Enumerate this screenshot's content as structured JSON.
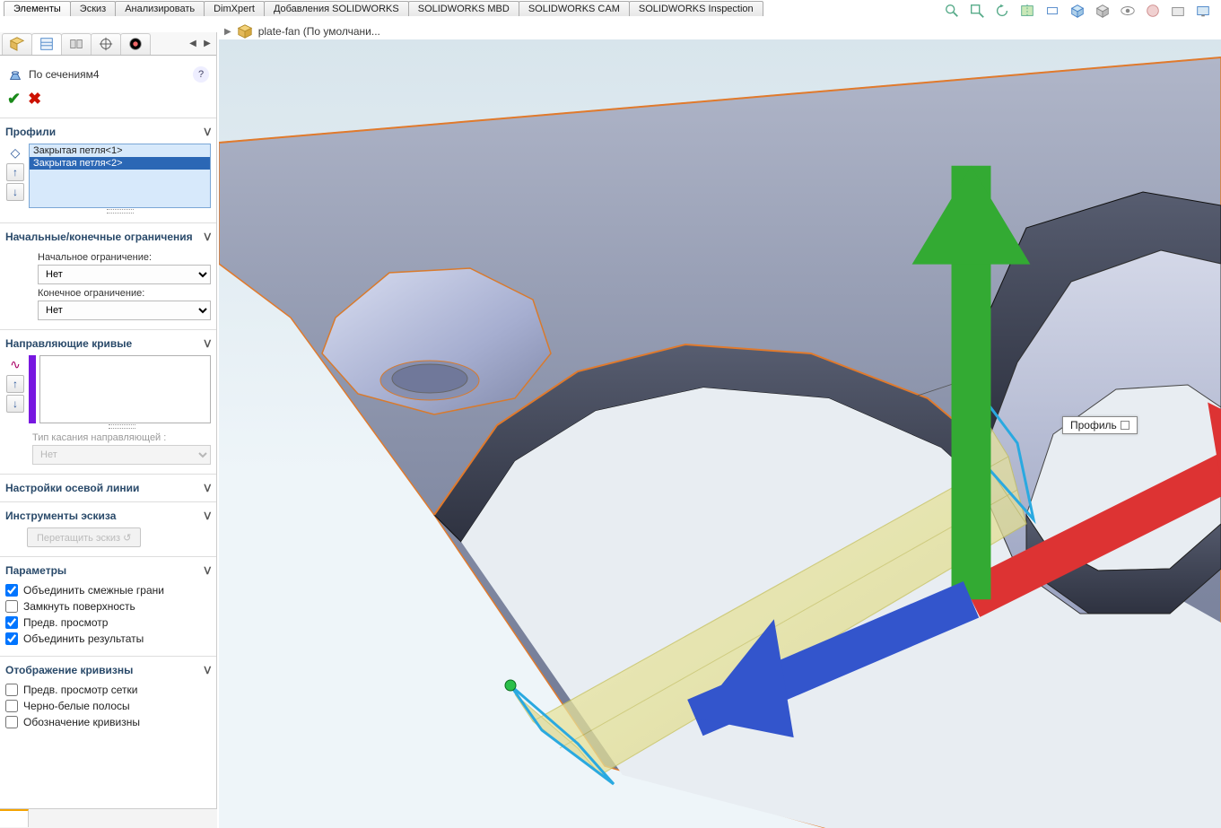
{
  "tabs": {
    "items": [
      "Элементы",
      "Эскиз",
      "Анализировать",
      "DimXpert",
      "Добавления SOLIDWORKS",
      "SOLIDWORKS MBD",
      "SOLIDWORKS CAM",
      "SOLIDWORKS Inspection"
    ],
    "active_index": 0
  },
  "breadcrumb": {
    "part_name": "plate-fan  (По умолчани..."
  },
  "feature": {
    "title": "По сечениям4",
    "help_tooltip": "?"
  },
  "profiles": {
    "header": "Профили",
    "items": [
      "Закрытая петля<1>",
      "Закрытая петля<2>"
    ],
    "selected_index": 1
  },
  "constraints": {
    "header": "Начальные/конечные ограничения",
    "start_label": "Начальное ограничение:",
    "start_value": "Нет",
    "end_label": "Конечное ограничение:",
    "end_value": "Нет"
  },
  "guides": {
    "header": "Направляющие кривые",
    "tangency_label": "Тип касания направляющей :",
    "tangency_value": "Нет"
  },
  "centerline": {
    "header": "Настройки осевой линии"
  },
  "sketchtools": {
    "header": "Инструменты эскиза",
    "drag_btn": "Перетащить эскиз"
  },
  "params": {
    "header": "Параметры",
    "merge_faces": "Объединить смежные грани",
    "close_surface": "Замкнуть поверхность",
    "preview": "Предв. просмотр",
    "merge_results": "Объединить результаты",
    "merge_faces_checked": true,
    "close_surface_checked": false,
    "preview_checked": true,
    "merge_results_checked": true
  },
  "curvature": {
    "header": "Отображение кривизны",
    "mesh_preview": "Предв. просмотр сетки",
    "zebra": "Черно-белые полосы",
    "curv_mark": "Обозначение кривизны",
    "mesh_preview_checked": false,
    "zebra_checked": false,
    "curv_mark_checked": false
  },
  "viewport": {
    "callout_label": "Профиль"
  },
  "colors": {
    "edge_highlight": "#e07a2d",
    "profile_highlight": "#2aa9e0",
    "loft_preview": "#e8e49a"
  }
}
